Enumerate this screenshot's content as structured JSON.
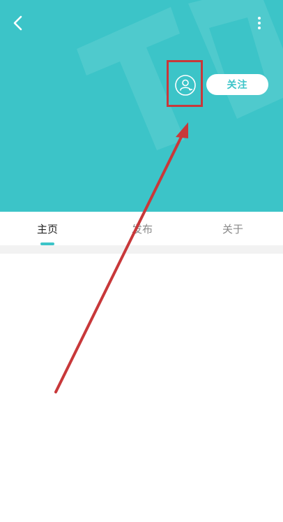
{
  "header": {
    "background_color": "#3cc4c8",
    "watermark_text": "TO",
    "back_icon": "chevron-left-icon",
    "more_icon": "vertical-dots-icon",
    "avatar_icon": "user-add-icon",
    "follow_label": "关注"
  },
  "tabs": [
    {
      "label": "主页",
      "active": true
    },
    {
      "label": "发布",
      "active": false
    },
    {
      "label": "关于",
      "active": false
    }
  ],
  "annotation": {
    "highlight_color": "#c8383a",
    "arrow_color": "#c8383a"
  }
}
